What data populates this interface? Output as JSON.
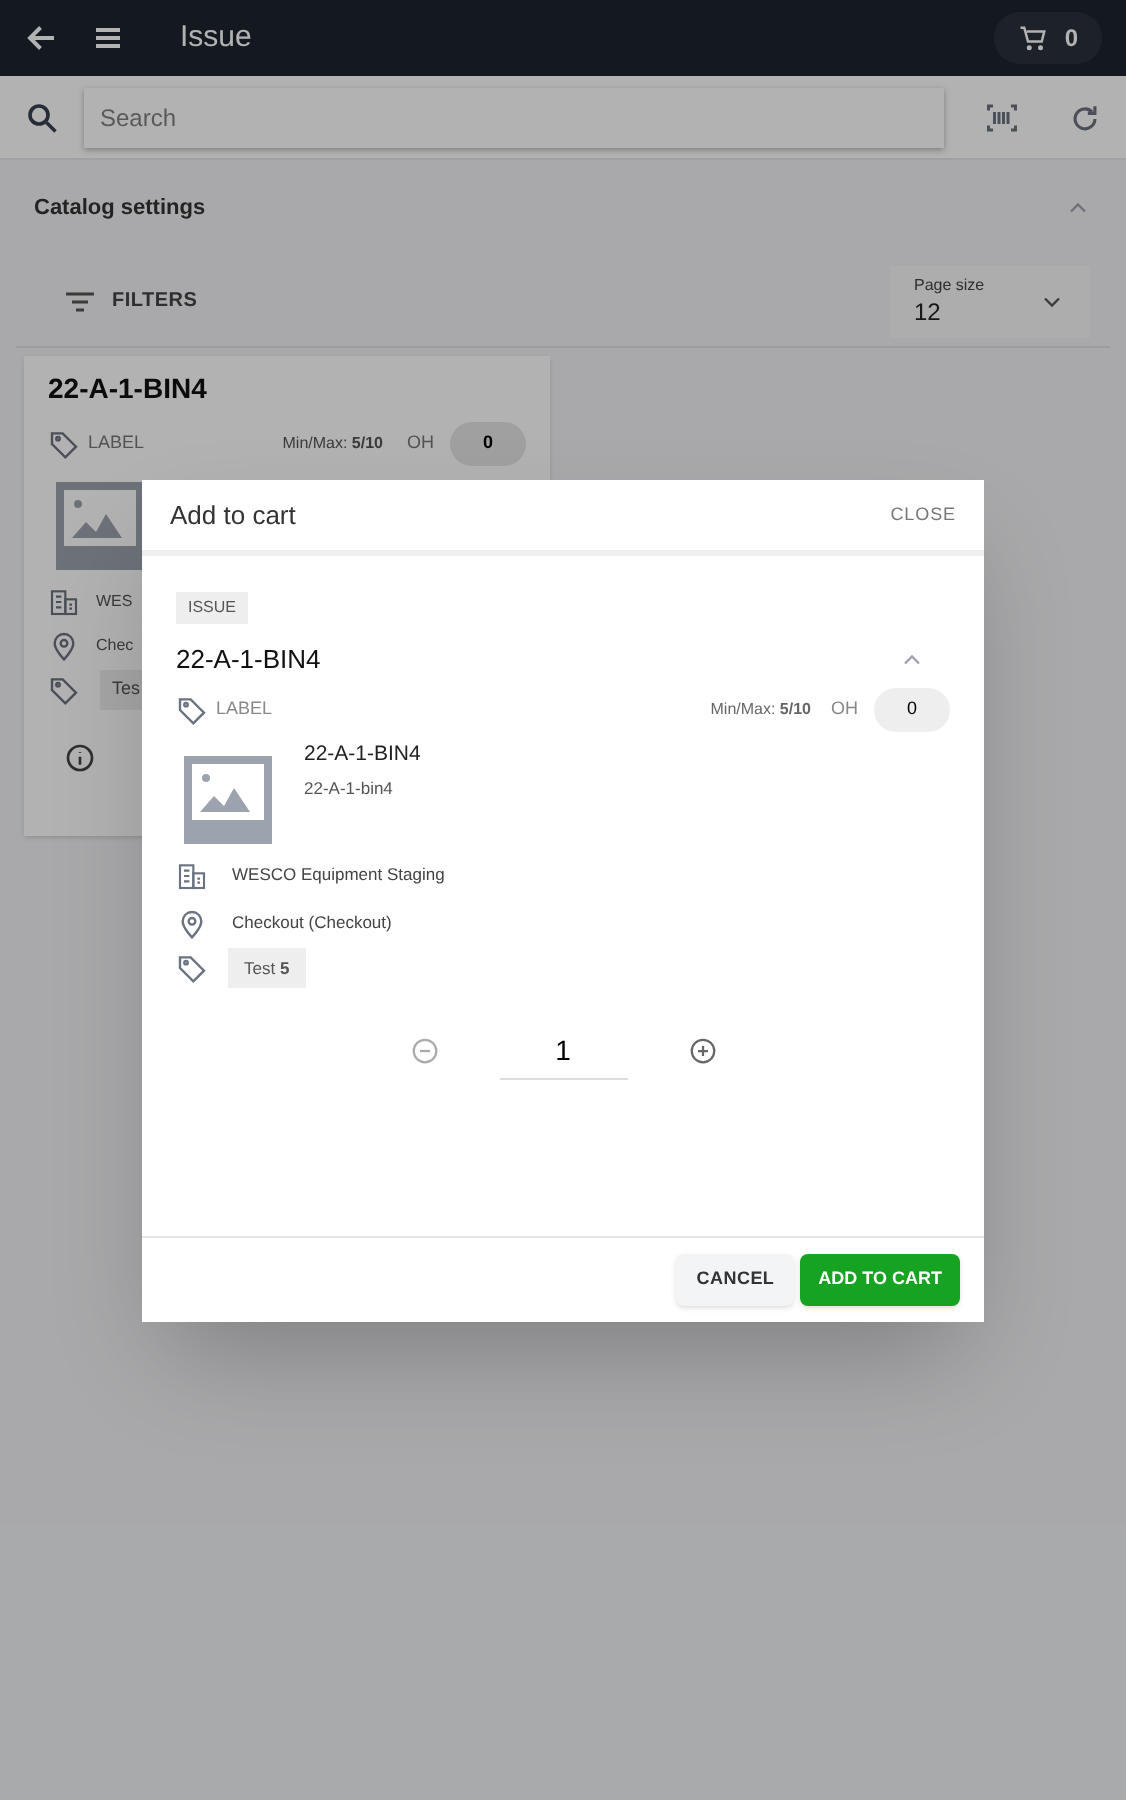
{
  "app_bar": {
    "title": "Issue",
    "cart_count": "0"
  },
  "search": {
    "placeholder": "Search"
  },
  "catalog_settings": {
    "title": "Catalog settings",
    "expanded": true,
    "filters_label": "FILTERS",
    "page_size": {
      "label": "Page size",
      "value": "12"
    }
  },
  "background_card": {
    "title": "22-A-1-BIN4",
    "label": "LABEL",
    "minmax": "Min/Max: **5/10**",
    "oh_label": "OH",
    "oh_value": "0",
    "details": [
      "WES",
      "Chec"
    ],
    "tag": "Tes"
  },
  "dialog": {
    "title": "Add to cart",
    "close": "CLOSE",
    "badge": "ISSUE",
    "item_title": "22-A-1-BIN4",
    "expanded": true,
    "label": "LABEL",
    "minmax": "Min/Max: **5/10**",
    "oh_label": "OH",
    "oh_value": "0",
    "product": {
      "name": "22-A-1-BIN4",
      "code": "22-A-1-bin4"
    },
    "details": [
      {
        "kind": "building",
        "text": "WESCO Equipment Staging"
      },
      {
        "kind": "location",
        "text": "Checkout (Checkout)"
      }
    ],
    "tag": "Test **5**",
    "quantity": "1",
    "buttons": [
      {
        "kind": "secondary",
        "label": "CANCEL"
      },
      {
        "kind": "primary",
        "label": "ADD TO CART"
      }
    ]
  }
}
